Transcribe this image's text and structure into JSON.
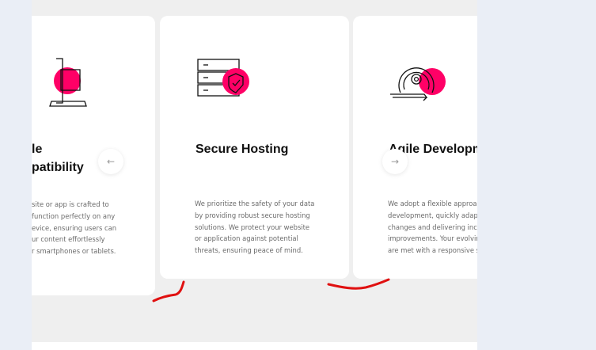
{
  "carousel": {
    "cards": [
      {
        "icon": "mobile-responsive-icon",
        "title_lines": [
          "le",
          "patibility"
        ],
        "description_lines": [
          "site or app is crafted to",
          "function perfectly on any",
          "evice, ensuring users can",
          "ur content effortlessly",
          "r smartphones or tablets."
        ]
      },
      {
        "icon": "server-shield-icon",
        "title": "Secure Hosting",
        "description_lines": [
          "We prioritize the safety of your data",
          "by providing robust secure hosting",
          "solutions. We protect your website",
          "or application against potential",
          "threats, ensuring peace of mind."
        ]
      },
      {
        "icon": "agile-cycle-gear-icon",
        "title": "Agile Developm",
        "description_lines": [
          "We adopt a flexible approac",
          "development, quickly adapt",
          "changes and delivering incre",
          "improvements. Your evolving",
          "are met with a responsive so"
        ]
      }
    ],
    "prev_arrow": "←",
    "next_arrow": "→"
  },
  "colors": {
    "accent": "#ff0066",
    "annotation": "#e01010",
    "card_background": "#ffffff",
    "section_background": "#efefef"
  }
}
